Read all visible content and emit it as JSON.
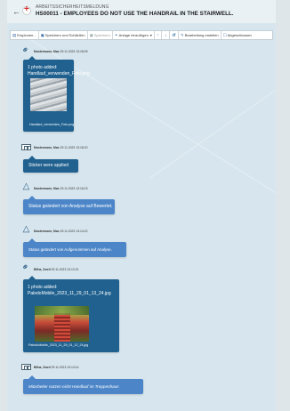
{
  "header": {
    "back_icon": "arrow-left-icon",
    "logo_icon": "red-cross-logo",
    "subtitle": "ARBEITSSICHERHEITSMELDUNG",
    "title": "HS00011 - EMPLOYEES DO NOT USE THE HANDRAIL IN THE STAIRWELL."
  },
  "toolbar": {
    "buttons": [
      {
        "label": "Ersplonen...",
        "icon": "document-icon"
      },
      {
        "label": "Speichern und Schließen",
        "icon": "save-close-icon"
      },
      {
        "label": "Speichern",
        "icon": "save-icon"
      },
      {
        "label": "Anlage hinzufügen",
        "icon": "paperclip-icon"
      },
      {
        "label": "↑",
        "icon": "arrow-up-icon"
      },
      {
        "label": "↓",
        "icon": "arrow-down-icon"
      },
      {
        "label": "↺",
        "icon": "refresh-icon"
      },
      {
        "label": "Bearbeitung erstellen",
        "icon": "edit-icon"
      },
      {
        "label": "Abgeschlossen",
        "icon": "check-icon"
      }
    ]
  },
  "timeline": [
    {
      "type": "attachment",
      "icon": "paperclip-icon",
      "author": "Mustermann, Max",
      "timestamp": "29.11.2023 13:18:09",
      "lines": [
        "1 photo added:",
        "Handlauf_verwenden_Foto.png"
      ],
      "caption": "Handlauf_verwenden_Foto.png"
    },
    {
      "type": "note",
      "icon": "sticker-icon",
      "author": "Mustermann, Max",
      "timestamp": "29.11.2023 13:18:20",
      "text": "Sticker were applied"
    },
    {
      "type": "status",
      "icon": "status-change-icon",
      "author": "Mustermann, Max",
      "timestamp": "29.11.2023 13:16:23",
      "text": "Status geändert von Analyse auf Bewertet."
    },
    {
      "type": "status",
      "icon": "status-change-icon",
      "author": "Mustermann, Max",
      "timestamp": "29.11.2023 13:14:22",
      "text": "Status geändert von Aufgenommen auf Analyse."
    },
    {
      "type": "attachment",
      "icon": "paperclip-icon",
      "author": "Bilha, Zweil",
      "timestamp": "29.11.2023 13:13:21",
      "lines": [
        "1 photo added:",
        "PaledoMobile_2023_11_29_01_13_24.jpg"
      ],
      "caption": "PaledoMobile_2023_11_29_01_12_24.jpg"
    },
    {
      "type": "note",
      "icon": "note-icon",
      "author": "Bilha, Zweil",
      "timestamp": "29.11.2023 13:13:14",
      "text": "Mitarbeiter nutzen nicht Handlauf im Treppenhaus"
    }
  ]
}
